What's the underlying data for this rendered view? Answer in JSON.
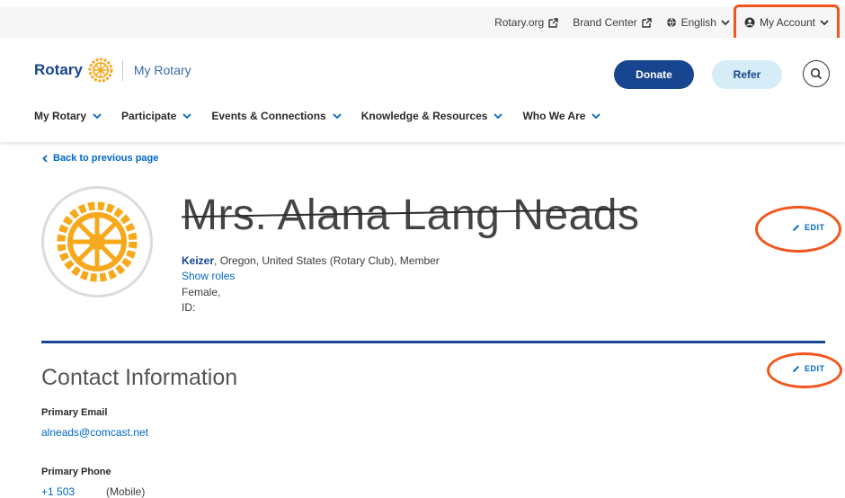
{
  "utility_bar": {
    "rotary_org": "Rotary.org",
    "brand_center": "Brand Center",
    "language": "English",
    "my_account": "My Account"
  },
  "header": {
    "logo_text": "Rotary",
    "site_name": "My Rotary",
    "donate_label": "Donate",
    "refer_label": "Refer"
  },
  "nav": {
    "items": [
      {
        "label": "My Rotary"
      },
      {
        "label": "Participate"
      },
      {
        "label": "Events & Connections"
      },
      {
        "label": "Knowledge & Resources"
      },
      {
        "label": "Who We Are"
      }
    ]
  },
  "back_link": "Back to previous page",
  "profile": {
    "name": "Mrs. Alana Lang Neads",
    "club_name": "Keizer",
    "club_details": ", Oregon, United States (Rotary Club), Member",
    "show_roles": "Show roles",
    "gender": "Female,",
    "id_label": "ID:",
    "edit_label": "EDIT"
  },
  "contact": {
    "title": "Contact Information",
    "edit_label": "EDIT",
    "email_label": "Primary Email",
    "email_value": "alneads@comcast.net",
    "phone_label": "Primary Phone",
    "phone_value": "+1 503",
    "phone_type": "(Mobile)"
  },
  "colors": {
    "brand_blue": "#17458f",
    "link_blue": "#0067c8",
    "gold": "#f7a81b",
    "annotation_orange": "#f2561c"
  }
}
